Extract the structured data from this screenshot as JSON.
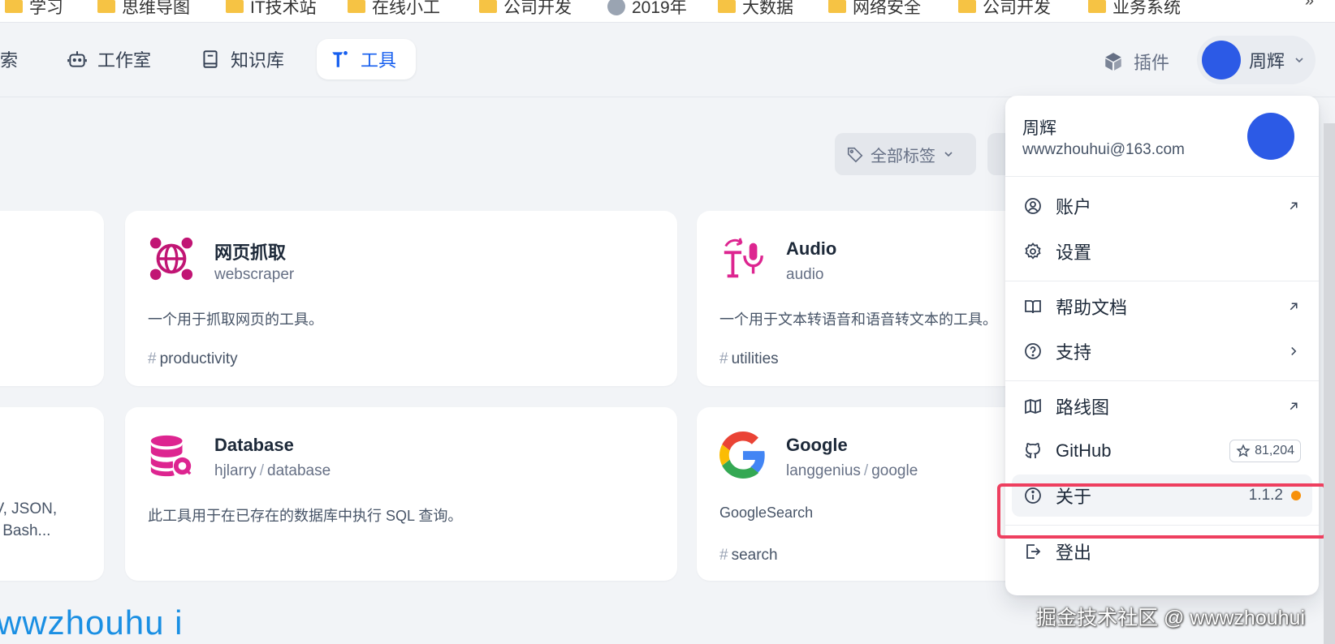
{
  "bookmarks": {
    "items": [
      {
        "label": "学习",
        "icon": "folder-icon"
      },
      {
        "label": "思维导图",
        "icon": "folder-icon"
      },
      {
        "label": "IT技术站",
        "icon": "folder-icon"
      },
      {
        "label": "在线小工",
        "icon": "folder-icon"
      },
      {
        "label": "公司开发",
        "icon": "folder-icon"
      },
      {
        "label": "2019年",
        "icon": "globe-icon"
      },
      {
        "label": "大数据",
        "icon": "folder-icon"
      },
      {
        "label": "网络安全",
        "icon": "folder-icon"
      },
      {
        "label": "公司开发",
        "icon": "folder-icon"
      },
      {
        "label": "业务系统",
        "icon": "folder-icon"
      }
    ],
    "more": "»"
  },
  "nav": {
    "explore": "索",
    "studio": "工作室",
    "knowledge": "知识库",
    "tools": "工具",
    "plugins": "插件",
    "user_name": "周辉"
  },
  "filter": {
    "tags_label": "全部标签"
  },
  "cards": [
    {
      "name": "网页抓取",
      "sub": "webscraper",
      "author": "",
      "description": "一个用于抓取网页的工具。",
      "tag": "productivity",
      "icon": "webscraper-globe-icon"
    },
    {
      "name": "Audio",
      "sub": "audio",
      "author": "",
      "description": "一个用于文本转语音和语音转文本的工具。",
      "tag": "utilities",
      "icon": "audio-tts-icon"
    },
    {
      "name": "Database",
      "author": "hjlarry",
      "sub": "database",
      "description": "此工具用于在已存在的数据库中执行 SQL 查询。",
      "tag": "",
      "icon": "database-search-icon"
    },
    {
      "name": "Google",
      "author": "langgenius",
      "sub": "google",
      "description": "GoogleSearch",
      "tag": "search",
      "icon": "google-logo-icon"
    }
  ],
  "left_card_partial": {
    "line1": "SV, JSON,",
    "line2": "S, Bash..."
  },
  "user_menu": {
    "name": "周辉",
    "email": "wwwzhouhui@163.com",
    "items": {
      "account": "账户",
      "settings": "设置",
      "help_docs": "帮助文档",
      "support": "支持",
      "roadmap": "路线图",
      "github": "GitHub",
      "github_stars": "81,204",
      "about": "关于",
      "version": "1.1.2",
      "logout": "登出"
    }
  },
  "watermarks": {
    "blue": "wwzhouhu i",
    "gray": "掘金技术社区 @ wwwzhouhui"
  },
  "colors": {
    "accent": "#155eef",
    "avatar": "#2c5ae6",
    "brand_pink": "#dd2590",
    "highlight_box": "#ee3f5f",
    "version_dot": "#f79009"
  }
}
